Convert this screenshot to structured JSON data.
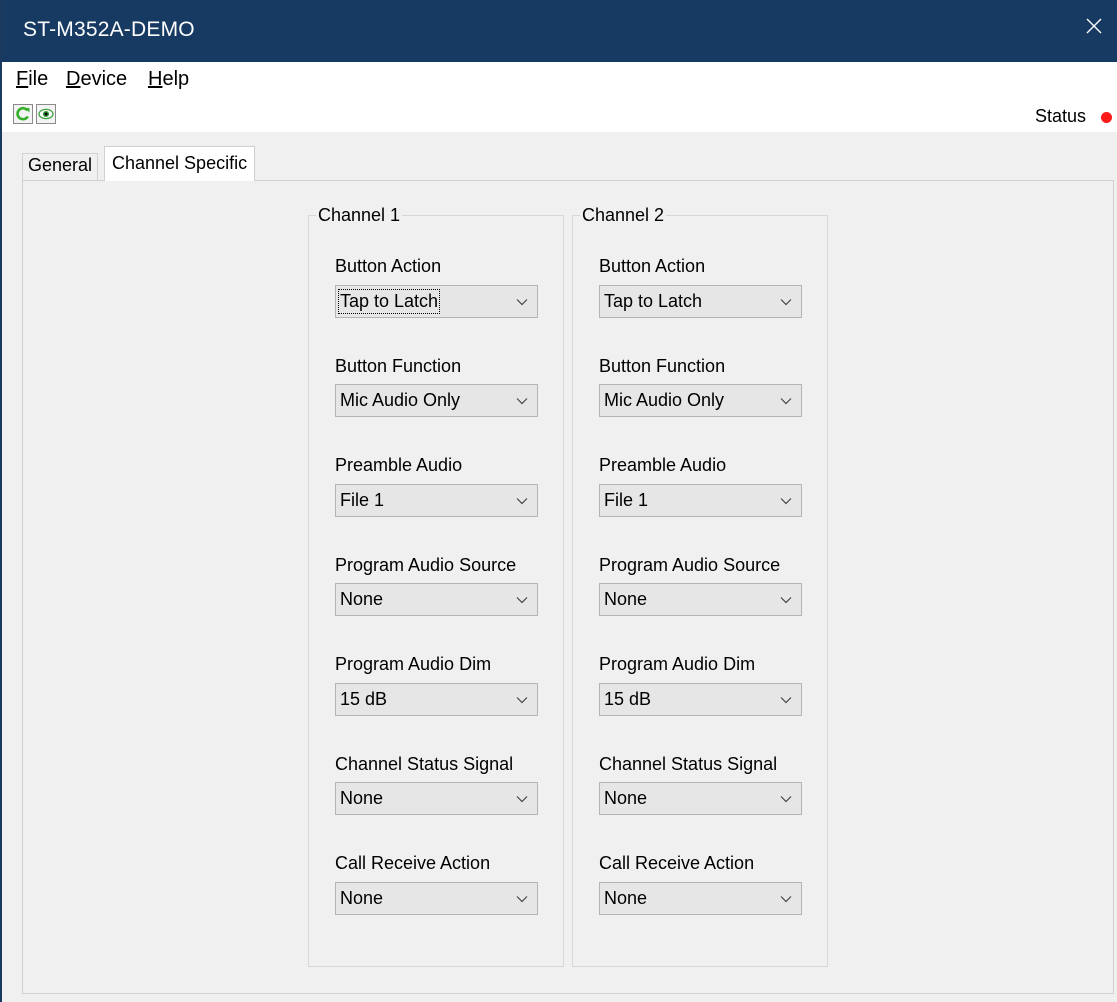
{
  "window": {
    "title": "ST-M352A-DEMO"
  },
  "menu": [
    {
      "accel": "F",
      "rest": "ile"
    },
    {
      "accel": "D",
      "rest": "evice"
    },
    {
      "accel": "H",
      "rest": "elp"
    }
  ],
  "toolbar": {
    "refresh_icon": "refresh-icon",
    "view_icon": "eye-icon",
    "status_label": "Status",
    "status_color": "#ff1a1a"
  },
  "tabs": {
    "general": "General",
    "channel_specific": "Channel Specific",
    "active": "Channel Specific"
  },
  "fields": {
    "button_action": "Button Action",
    "button_function": "Button Function",
    "preamble_audio": "Preamble Audio",
    "program_audio_source": "Program Audio Source",
    "program_audio_dim": "Program Audio Dim",
    "channel_status_signal": "Channel Status Signal",
    "call_receive_action": "Call Receive Action"
  },
  "channels": [
    {
      "title": "Channel 1",
      "button_action": "Tap to Latch",
      "button_function": "Mic Audio Only",
      "preamble_audio": "File 1",
      "program_audio_source": "None",
      "program_audio_dim": "15 dB",
      "channel_status_signal": "None",
      "call_receive_action": "None"
    },
    {
      "title": "Channel 2",
      "button_action": "Tap to Latch",
      "button_function": "Mic Audio Only",
      "preamble_audio": "File 1",
      "program_audio_source": "None",
      "program_audio_dim": "15 dB",
      "channel_status_signal": "None",
      "call_receive_action": "None"
    }
  ]
}
